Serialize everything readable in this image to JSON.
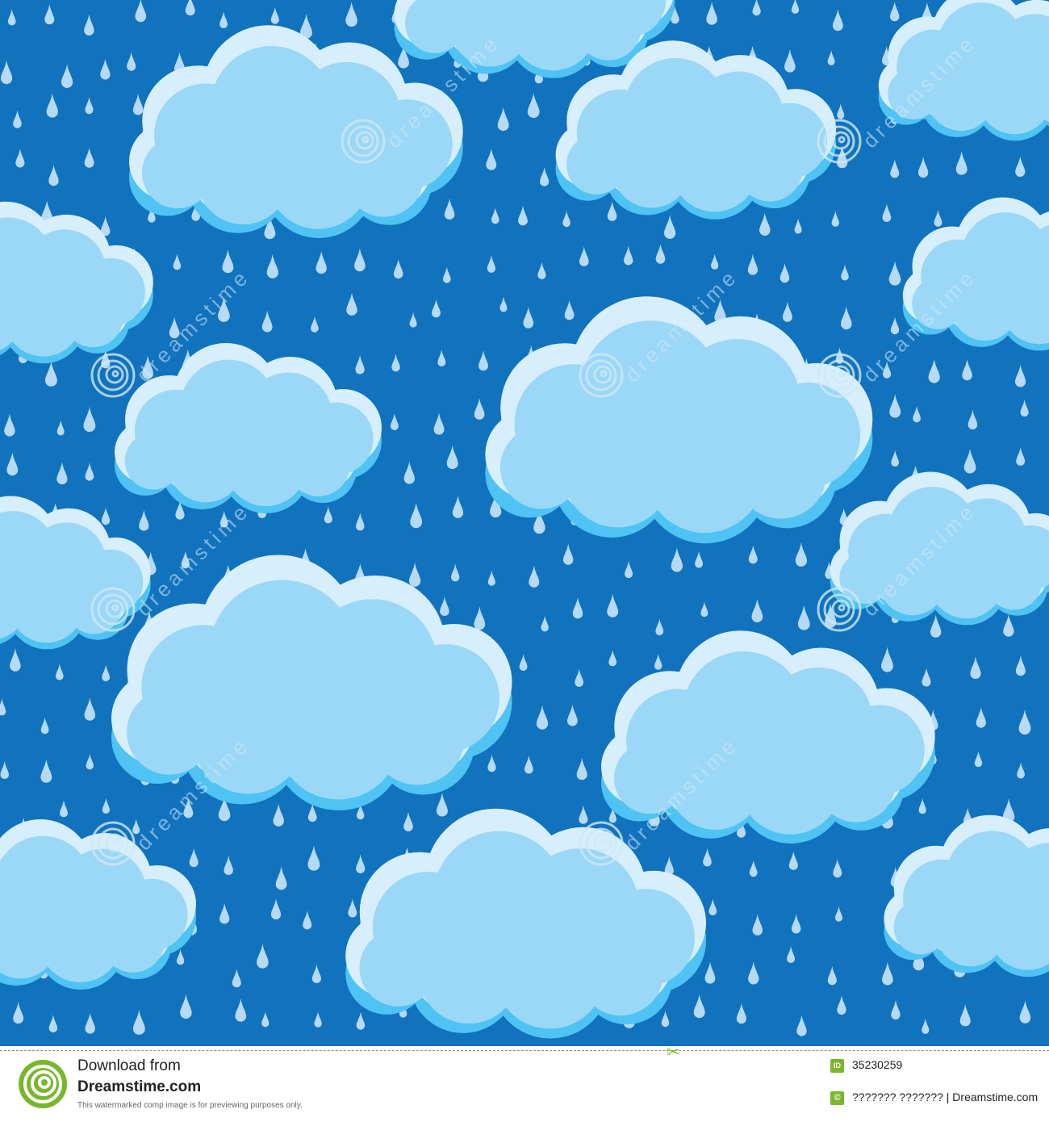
{
  "colors": {
    "sky": "#1172bd",
    "drop": "#b6daf5",
    "cloud_shadow": "#4ec3f4",
    "cloud_body": "#9bd8f7",
    "cloud_highlight": "#d7effc",
    "watermark": "#cfe9f8",
    "brand_green": "#7ab62c"
  },
  "watermark": {
    "text": "dreamstime"
  },
  "footer": {
    "download_line1": "Download from",
    "download_line2": "Dreamstime.com",
    "disclaimer": "This watermarked comp image is for previewing purposes only.",
    "id_badge": "ID",
    "image_id": "35230259",
    "copyright_badge": "©",
    "credit": "??????? ??????? | Dreamstime.com",
    "icons": {
      "logo": "dreamstime-spiral-logo",
      "scissors": "scissors-icon"
    }
  }
}
